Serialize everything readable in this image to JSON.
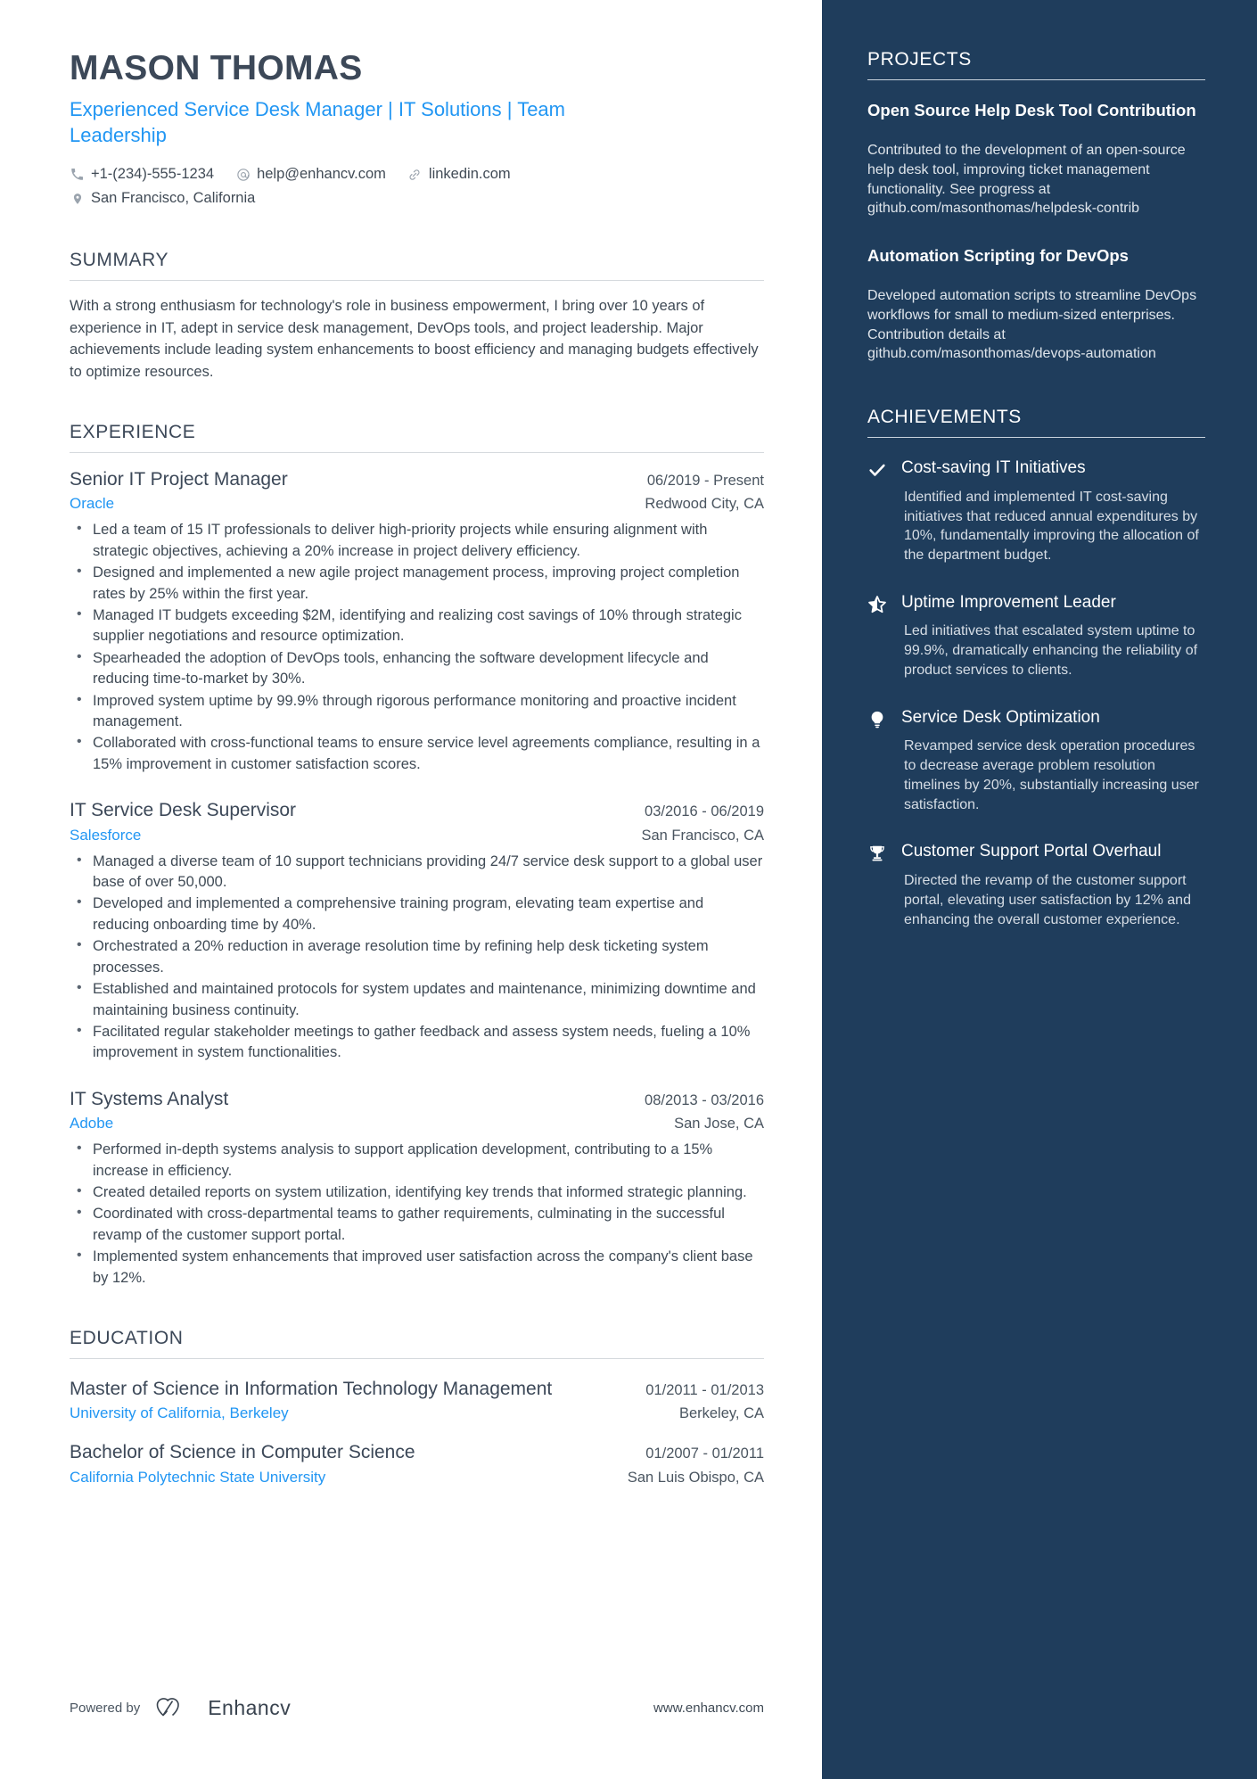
{
  "header": {
    "name": "MASON THOMAS",
    "headline": "Experienced Service Desk Manager | IT Solutions | Team Leadership",
    "contacts": [
      {
        "icon": "phone-icon",
        "text": "+1-(234)-555-1234"
      },
      {
        "icon": "email-icon",
        "text": "help@enhancv.com"
      },
      {
        "icon": "link-icon",
        "text": "linkedin.com"
      }
    ],
    "location": {
      "icon": "location-pin-icon",
      "text": "San Francisco, California"
    }
  },
  "summary": {
    "title": "SUMMARY",
    "text": "With a strong enthusiasm for technology's role in business empowerment, I bring over 10 years of experience in IT, adept in service desk management, DevOps tools, and project leadership. Major achievements include leading system enhancements to boost efficiency and managing budgets effectively to optimize resources."
  },
  "experience": {
    "title": "EXPERIENCE",
    "entries": [
      {
        "role": "Senior IT Project Manager",
        "date": "06/2019 - Present",
        "company": "Oracle",
        "location": "Redwood City, CA",
        "bullets": [
          "Led a team of 15 IT professionals to deliver high-priority projects while ensuring alignment with strategic objectives, achieving a 20% increase in project delivery efficiency.",
          "Designed and implemented a new agile project management process, improving project completion rates by 25% within the first year.",
          "Managed IT budgets exceeding $2M, identifying and realizing cost savings of 10% through strategic supplier negotiations and resource optimization.",
          "Spearheaded the adoption of DevOps tools, enhancing the software development lifecycle and reducing time-to-market by 30%.",
          "Improved system uptime by 99.9% through rigorous performance monitoring and proactive incident management.",
          "Collaborated with cross-functional teams to ensure service level agreements compliance, resulting in a 15% improvement in customer satisfaction scores."
        ]
      },
      {
        "role": "IT Service Desk Supervisor",
        "date": "03/2016 - 06/2019",
        "company": "Salesforce",
        "location": "San Francisco, CA",
        "bullets": [
          "Managed a diverse team of 10 support technicians providing 24/7 service desk support to a global user base of over 50,000.",
          "Developed and implemented a comprehensive training program, elevating team expertise and reducing onboarding time by 40%.",
          "Orchestrated a 20% reduction in average resolution time by refining help desk ticketing system processes.",
          "Established and maintained protocols for system updates and maintenance, minimizing downtime and maintaining business continuity.",
          "Facilitated regular stakeholder meetings to gather feedback and assess system needs, fueling a 10% improvement in system functionalities."
        ]
      },
      {
        "role": "IT Systems Analyst",
        "date": "08/2013 - 03/2016",
        "company": "Adobe",
        "location": "San Jose, CA",
        "bullets": [
          "Performed in-depth systems analysis to support application development, contributing to a 15% increase in efficiency.",
          "Created detailed reports on system utilization, identifying key trends that informed strategic planning.",
          "Coordinated with cross-departmental teams to gather requirements, culminating in the successful revamp of the customer support portal.",
          "Implemented system enhancements that improved user satisfaction across the company's client base by 12%."
        ]
      }
    ]
  },
  "education": {
    "title": "EDUCATION",
    "entries": [
      {
        "degree": "Master of Science in Information Technology Management",
        "date": "01/2011 - 01/2013",
        "school": "University of California, Berkeley",
        "location": "Berkeley, CA"
      },
      {
        "degree": "Bachelor of Science in Computer Science",
        "date": "01/2007 - 01/2011",
        "school": "California Polytechnic State University",
        "location": "San Luis Obispo, CA"
      }
    ]
  },
  "projects": {
    "title": "PROJECTS",
    "items": [
      {
        "title": "Open Source Help Desk Tool Contribution",
        "description": "Contributed to the development of an open-source help desk tool, improving ticket management functionality. See progress at github.com/masonthomas/helpdesk-contrib"
      },
      {
        "title": "Automation Scripting for DevOps",
        "description": "Developed automation scripts to streamline DevOps workflows for small to medium-sized enterprises. Contribution details at github.com/masonthomas/devops-automation"
      }
    ]
  },
  "achievements": {
    "title": "ACHIEVEMENTS",
    "items": [
      {
        "icon": "check-icon",
        "title": "Cost-saving IT Initiatives",
        "description": "Identified and implemented IT cost-saving initiatives that reduced annual expenditures by 10%, fundamentally improving the allocation of the department budget."
      },
      {
        "icon": "half-star-icon",
        "title": "Uptime Improvement Leader",
        "description": "Led initiatives that escalated system uptime to 99.9%, dramatically enhancing the reliability of product services to clients."
      },
      {
        "icon": "lightbulb-icon",
        "title": "Service Desk Optimization",
        "description": "Revamped service desk operation procedures to decrease average problem resolution timelines by 20%, substantially increasing user satisfaction."
      },
      {
        "icon": "trophy-icon",
        "title": "Customer Support Portal Overhaul",
        "description": "Directed the revamp of the customer support portal, elevating user satisfaction by 12% and enhancing the overall customer experience."
      }
    ]
  },
  "footer": {
    "powered_by": "Powered by",
    "brand": "Enhancv",
    "website": "www.enhancv.com"
  },
  "colors": {
    "accent_blue": "#2196f3",
    "sidebar_bg": "#1f3d5c",
    "heading_text": "#3c4858",
    "body_text": "#3f4a55"
  }
}
